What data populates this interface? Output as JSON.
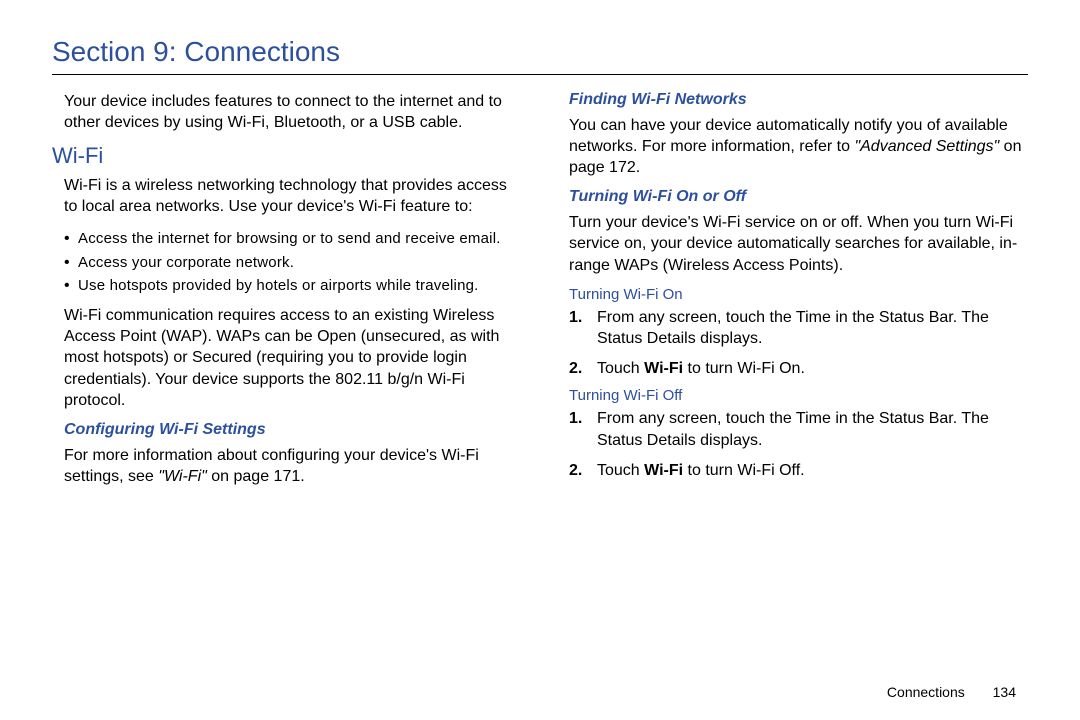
{
  "title": "Section 9: Connections",
  "intro": "Your device includes features to connect to the internet and to other devices by using Wi-Fi, Bluetooth, or a USB cable.",
  "wifi": {
    "heading": "Wi-Fi",
    "lead": "Wi-Fi is a wireless networking technology that provides access to local area networks. Use your device's Wi-Fi feature to:",
    "bullets": [
      "Access the internet for browsing or to send and receive email.",
      "Access your corporate network.",
      "Use hotspots provided by hotels or airports while traveling."
    ],
    "wap": "Wi-Fi communication requires access to an existing Wireless Access Point (WAP). WAPs can be Open (unsecured, as with most hotspots) or Secured (requiring you to provide login credentials). Your device supports the 802.11 b/g/n Wi-Fi protocol.",
    "configuring": {
      "heading": "Configuring Wi-Fi Settings",
      "text_prefix": "For more information about configuring your device's Wi-Fi settings, see ",
      "ref": "\"Wi-Fi\"",
      "text_suffix": " on page 171."
    }
  },
  "right": {
    "finding": {
      "heading": "Finding Wi-Fi Networks",
      "text_prefix": "You can have your device automatically notify you of available networks. For more information, refer to ",
      "ref": "\"Advanced Settings\"",
      "text_suffix": "  on page 172."
    },
    "turning": {
      "heading": "Turning Wi-Fi On or Off",
      "lead": "Turn your device's Wi-Fi service on or off. When you turn Wi-Fi service on, your device automatically searches for available, in-range WAPs (Wireless Access Points).",
      "on": {
        "heading": "Turning Wi-Fi On",
        "step1": "From any screen, touch the Time in the Status Bar. The Status Details displays.",
        "step2_pre": "Touch ",
        "step2_bold": "Wi-Fi",
        "step2_post": " to turn Wi-Fi On."
      },
      "off": {
        "heading": "Turning Wi-Fi Off",
        "step1": "From any screen, touch the Time in the Status Bar. The Status Details displays.",
        "step2_pre": "Touch ",
        "step2_bold": "Wi-Fi",
        "step2_post": " to turn Wi-Fi Off."
      }
    }
  },
  "footer": {
    "chapter": "Connections",
    "page": "134"
  }
}
